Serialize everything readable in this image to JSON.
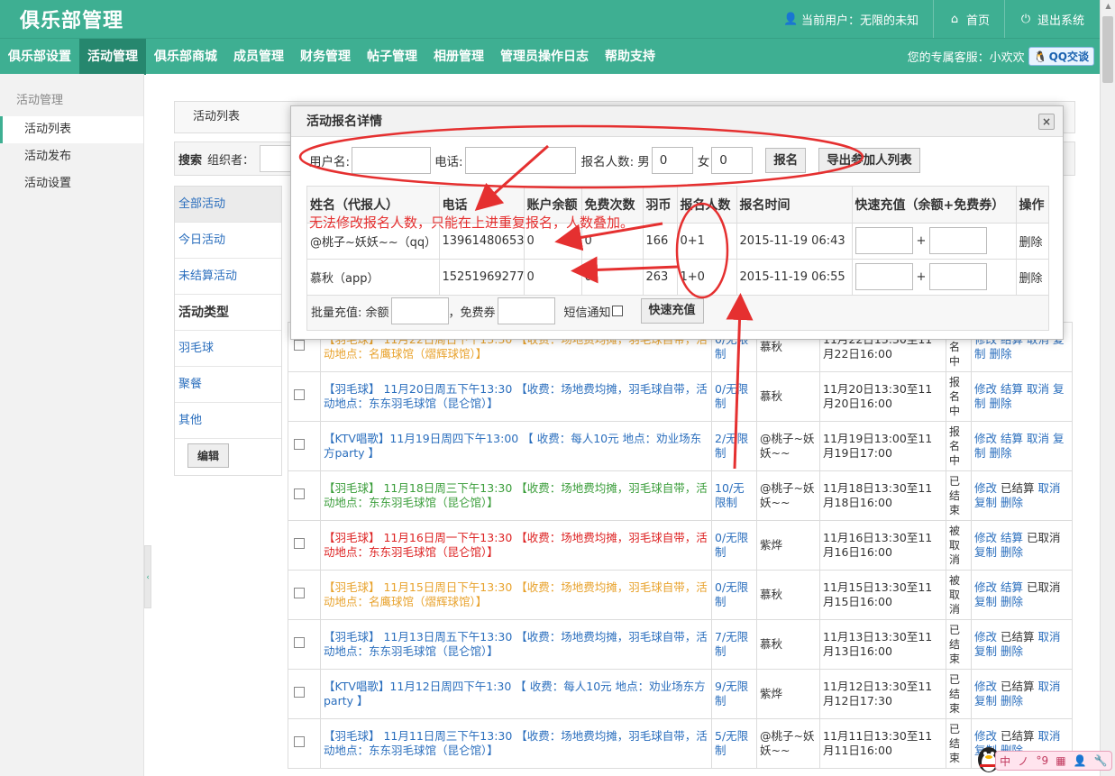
{
  "header": {
    "brand": "俱乐部管理",
    "current_user": "当前用户：无限的未知",
    "home": "首页",
    "logout": "退出系统"
  },
  "nav": {
    "items": [
      "俱乐部设置",
      "活动管理",
      "俱乐部商城",
      "成员管理",
      "财务管理",
      "帖子管理",
      "相册管理",
      "管理员操作日志",
      "帮助支持"
    ],
    "active_index": 1,
    "service_label": "您的专属客服：小欢欢",
    "qq_button": "QQ交谈"
  },
  "sidebar": {
    "title": "活动管理",
    "items": [
      "活动列表",
      "活动发布",
      "活动设置"
    ],
    "active_index": 0
  },
  "breadcrumb": "活动列表",
  "search": {
    "label": "搜索",
    "organizer_label": "组织者："
  },
  "categories": {
    "items": [
      "全部活动",
      "今日活动",
      "未结算活动"
    ],
    "type_heading": "活动类型",
    "types": [
      "羽毛球",
      "聚餐",
      "其他"
    ],
    "edit_button": "编辑"
  },
  "activities": [
    {
      "title": "【羽毛球】 11月22日周日下午13:30 【收费：场地费均摊，羽毛球自带，活动地点：名鹰球馆（熠辉球馆）】",
      "color": "orange",
      "count": "0/无限制",
      "organizer": "慕秋",
      "time": "11月22日13:30至11月22日16:00",
      "status": "报名中",
      "ops": [
        "修改",
        "结算",
        "取消",
        "复制",
        "删除"
      ],
      "plain_index": -1
    },
    {
      "title": "【羽毛球】 11月20日周五下午13:30 【收费：场地费均摊，羽毛球自带，活动地点：东东羽毛球馆（昆仑馆）】",
      "color": "blue",
      "count": "0/无限制",
      "organizer": "慕秋",
      "time": "11月20日13:30至11月20日16:00",
      "status": "报名中",
      "ops": [
        "修改",
        "结算",
        "取消",
        "复制",
        "删除"
      ],
      "plain_index": -1
    },
    {
      "title": "【KTV唱歌】11月19日周四下午13:00 【 收费：每人10元 地点：劝业场东方party 】",
      "color": "blue",
      "count": "2/无限制",
      "organizer": "@桃子~妖妖~~",
      "time": "11月19日13:00至11月19日17:00",
      "status": "报名中",
      "ops": [
        "修改",
        "结算",
        "取消",
        "复制",
        "删除"
      ],
      "plain_index": -1
    },
    {
      "title": "【羽毛球】 11月18日周三下午13:30 【收费：场地费均摊，羽毛球自带，活动地点：东东羽毛球馆（昆仑馆）】",
      "color": "green",
      "count": "10/无限制",
      "organizer": "@桃子~妖妖~~",
      "time": "11月18日13:30至11月18日16:00",
      "status": "已结束",
      "ops": [
        "修改",
        "已结算",
        "取消",
        "复制",
        "删除"
      ],
      "plain_index": 1
    },
    {
      "title": "【羽毛球】 11月16日周一下午13:30 【收费：场地费均摊，羽毛球自带，活动地点：东东羽毛球馆（昆仑馆）】",
      "color": "red",
      "count": "0/无限制",
      "organizer": "紫烨",
      "time": "11月16日13:30至11月16日16:00",
      "status": "被取消",
      "ops": [
        "修改",
        "结算",
        "已取消",
        "复制",
        "删除"
      ],
      "plain_index": 2
    },
    {
      "title": "【羽毛球】 11月15日周日下午13:30 【收费：场地费均摊，羽毛球自带，活动地点：名鹰球馆（熠辉球馆）】",
      "color": "orange",
      "count": "0/无限制",
      "organizer": "慕秋",
      "time": "11月15日13:30至11月15日16:00",
      "status": "被取消",
      "ops": [
        "修改",
        "结算",
        "已取消",
        "复制",
        "删除"
      ],
      "plain_index": 2
    },
    {
      "title": "【羽毛球】 11月13日周五下午13:30 【收费：场地费均摊，羽毛球自带，活动地点：东东羽毛球馆（昆仑馆）】",
      "color": "blue",
      "count": "7/无限制",
      "organizer": "慕秋",
      "time": "11月13日13:30至11月13日16:00",
      "status": "已结束",
      "ops": [
        "修改",
        "已结算",
        "取消",
        "复制",
        "删除"
      ],
      "plain_index": 1
    },
    {
      "title": "【KTV唱歌】11月12日周四下午1:30 【 收费：每人10元 地点：劝业场东方party 】",
      "color": "blue",
      "count": "9/无限制",
      "organizer": "紫烨",
      "time": "11月12日13:30至11月12日17:30",
      "status": "已结束",
      "ops": [
        "修改",
        "已结算",
        "取消",
        "复制",
        "删除"
      ],
      "plain_index": 1
    },
    {
      "title": "【羽毛球】 11月11日周三下午13:30 【收费：场地费均摊，羽毛球自带，活动地点：东东羽毛球馆（昆仑馆）】",
      "color": "blue",
      "count": "5/无限制",
      "organizer": "@桃子~妖妖~~",
      "time": "11月11日13:30至11月11日16:00",
      "status": "已结束",
      "ops": [
        "修改",
        "已结算",
        "取消",
        "复制",
        "删除"
      ],
      "plain_index": 1
    }
  ],
  "modal": {
    "title": "活动报名详情",
    "close": "×",
    "filter": {
      "username_label": "用户名:",
      "phone_label": "电话:",
      "count_label": "报名人数:",
      "male_label": "男",
      "male_value": "0",
      "female_label": "女",
      "female_value": "0",
      "signup_button": "报名",
      "export_button": "导出参加人列表"
    },
    "columns": [
      "姓名（代报人）",
      "电话",
      "账户余额",
      "免费次数",
      "羽币",
      "报名人数",
      "报名时间",
      "快速充值（余额+免费券）",
      "操作"
    ],
    "rows": [
      {
        "name": "@桃子~妖妖~~（qq）",
        "phone": "13961480653",
        "balance": "0",
        "free": "0",
        "coins": "166",
        "count": "0+1",
        "time": "2015-11-19 06:43",
        "delete": "删除"
      },
      {
        "name": "慕秋（app）",
        "phone": "15251969277",
        "balance": "0",
        "free": "0",
        "coins": "263",
        "count": "1+0",
        "time": "2015-11-19 06:55",
        "delete": "删除"
      }
    ],
    "plus": "+",
    "batch": {
      "label": "批量充值: 余额",
      "coupon_label": "，免费券",
      "sms_label": "短信通知",
      "button": "快速充值"
    }
  },
  "annotation": {
    "text": "无法修改报名人数，只能在上进重复报名，人数叠加。",
    "color": "#e53030"
  },
  "ime": {
    "items": [
      "中",
      "ノ",
      "°9",
      "▦",
      "👤",
      "🔧"
    ]
  },
  "colors": {
    "brand": "#3eaf92",
    "nav_active": "#26876e",
    "link": "#2a6ebd"
  }
}
